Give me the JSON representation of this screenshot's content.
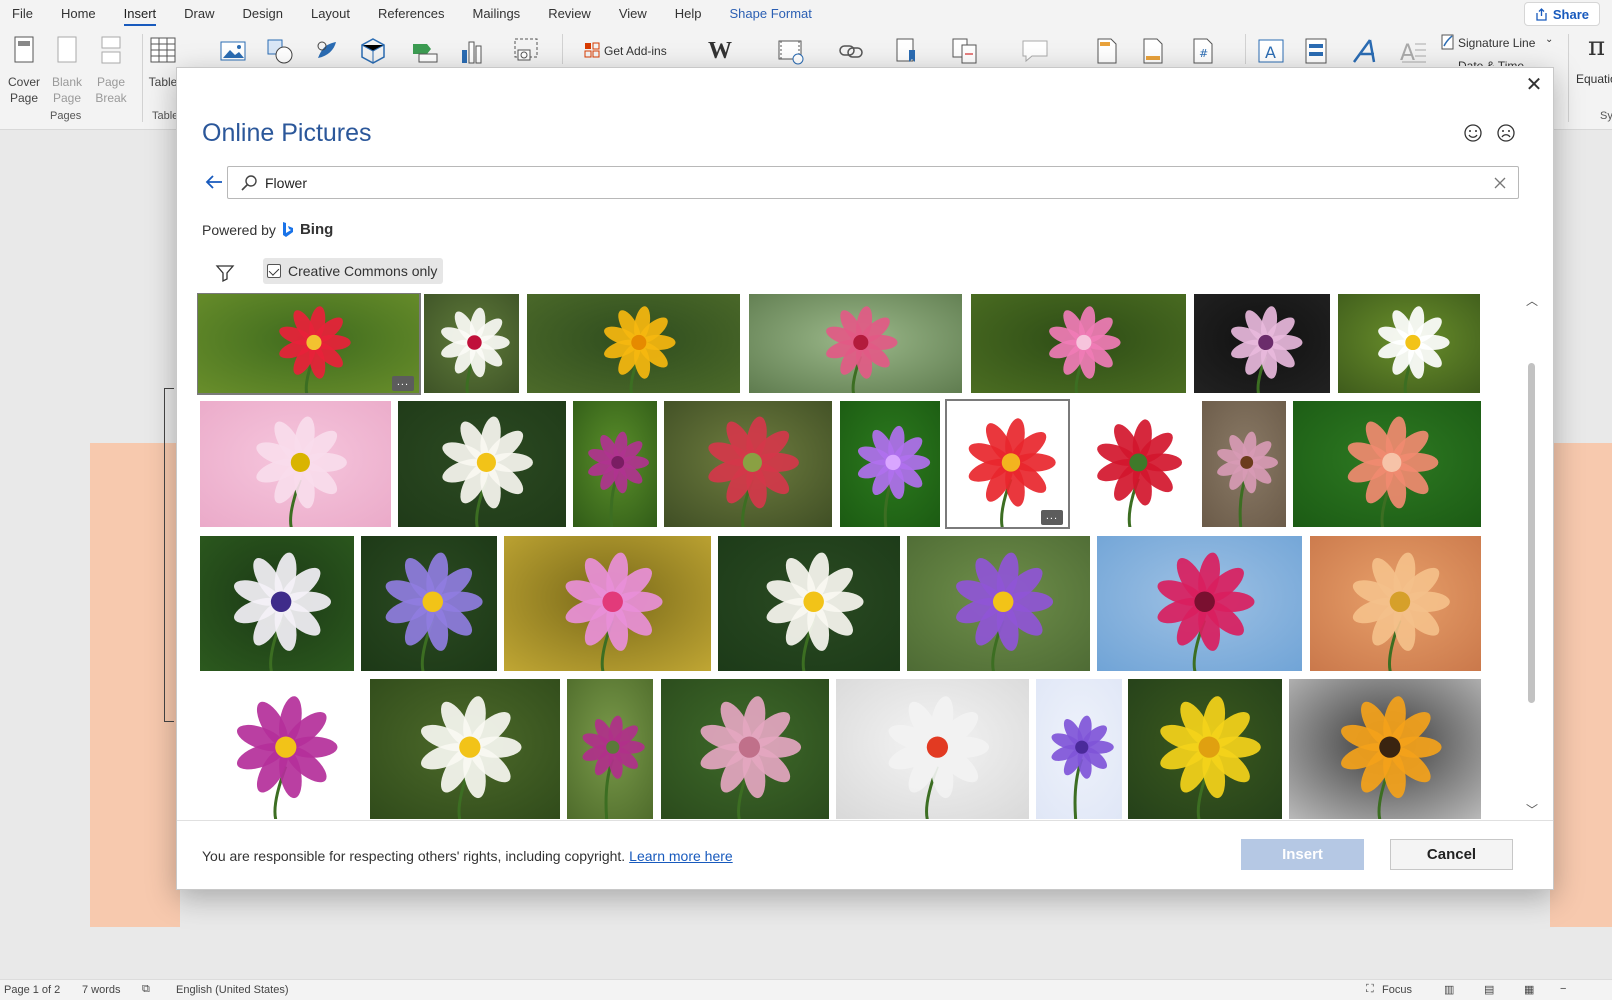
{
  "menu": {
    "items": [
      "File",
      "Home",
      "Insert",
      "Draw",
      "Design",
      "Layout",
      "References",
      "Mailings",
      "Review",
      "View",
      "Help",
      "Shape Format"
    ],
    "share_label": "Share"
  },
  "ribbon": {
    "cover_page": "Cover Page",
    "blank_page": "Blank Page",
    "page_break": "Page Break",
    "pages_group": "Pages",
    "table_label": "Table",
    "tables_group": "Tables",
    "get_addins": "Get Add-ins",
    "signature_line": "Signature Line",
    "date_time": "Date & Time",
    "equation": "Equation",
    "symbols_group": "Sy"
  },
  "dialog": {
    "title": "Online Pictures",
    "search_value": "Flower",
    "powered_by": "Powered by",
    "bing": "Bing",
    "filter_chip": "Creative Commons only",
    "footer_text": "You are responsible for respecting others' rights, including copyright.",
    "learn_more": "Learn more here",
    "insert_label": "Insert",
    "cancel_label": "Cancel",
    "more_label": "...",
    "images": [
      [
        "red-dahlia",
        "white-hibiscus",
        "yellow-rose",
        "rose-bouquet-vase",
        "pink-dahlia",
        "pink-clematis",
        "white-daisy"
      ],
      [
        "pink-daisies",
        "white-plumeria",
        "purple-tulip-bud",
        "red-tulip-buds",
        "purple-mimosa",
        "flower-wreath",
        "red-rose-bouquet",
        "coneflower",
        "salmon-lily"
      ],
      [
        "passion-flower-butterfly",
        "purple-water-lily",
        "pink-aster",
        "white-plumeria-2",
        "purple-potato-flower",
        "pink-gerbera-sky",
        "orange-mums"
      ],
      [
        "purple-lotus",
        "white-lily",
        "thistle",
        "clover-flower",
        "white-red-gerbera",
        "purple-sweet-pea",
        "yellow-shrub-flowers",
        "orange-marigold-hand"
      ]
    ]
  },
  "status": {
    "page": "Page 1 of 2",
    "words": "7 words",
    "language": "English (United States)",
    "focus": "Focus"
  },
  "colors": {
    "accent": "#185abd",
    "title": "#2b579a",
    "shape_fill": "#f7c9ae"
  }
}
